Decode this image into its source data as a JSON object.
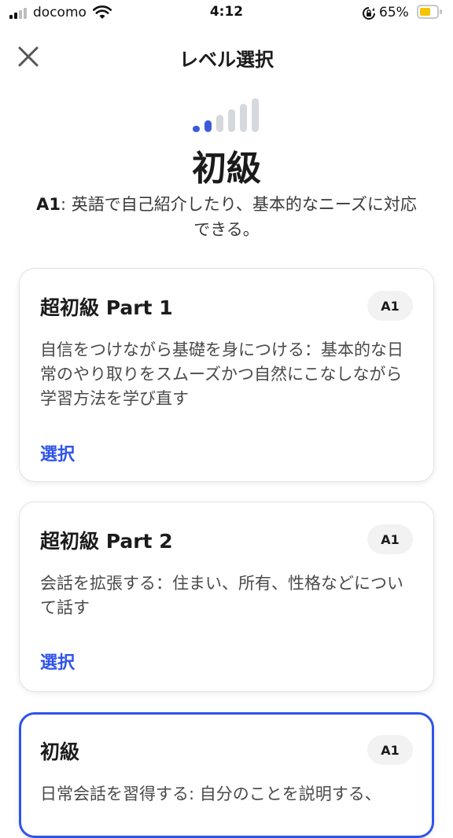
{
  "status_bar": {
    "carrier": "docomo",
    "time": "4:12",
    "battery_percent": "65%",
    "battery_level": 0.65,
    "icons": [
      "signal-icon",
      "wifi-icon",
      "rotation-lock-icon",
      "battery-icon"
    ]
  },
  "header": {
    "title": "レベル選択",
    "close_icon": "close-icon"
  },
  "level": {
    "meter_total_bars": 6,
    "meter_active_bars": 2,
    "meter_active_color": "#3b5bdb",
    "meter_inactive_color": "#d5d8dd",
    "title": "初級",
    "code": "A1",
    "description": ": 英語で自己紹介したり、基本的なニーズに対応できる。"
  },
  "courses": [
    {
      "title": "超初級 Part 1",
      "badge": "A1",
      "description": "自信をつけながら基礎を身につける：基本的な日常のやり取りをスムーズかつ自然にこなしながら学習方法を学び直す",
      "select_label": "選択",
      "selected": false
    },
    {
      "title": "超初級 Part 2",
      "badge": "A1",
      "description": "会話を拡張する：住まい、所有、性格などについて話す",
      "select_label": "選択",
      "selected": false
    },
    {
      "title": "初級",
      "badge": "A1",
      "description": "日常会話を習得する: 自分のことを説明する、",
      "selected": true
    }
  ],
  "colors": {
    "accent": "#2f54eb",
    "battery": "#f5c400"
  }
}
